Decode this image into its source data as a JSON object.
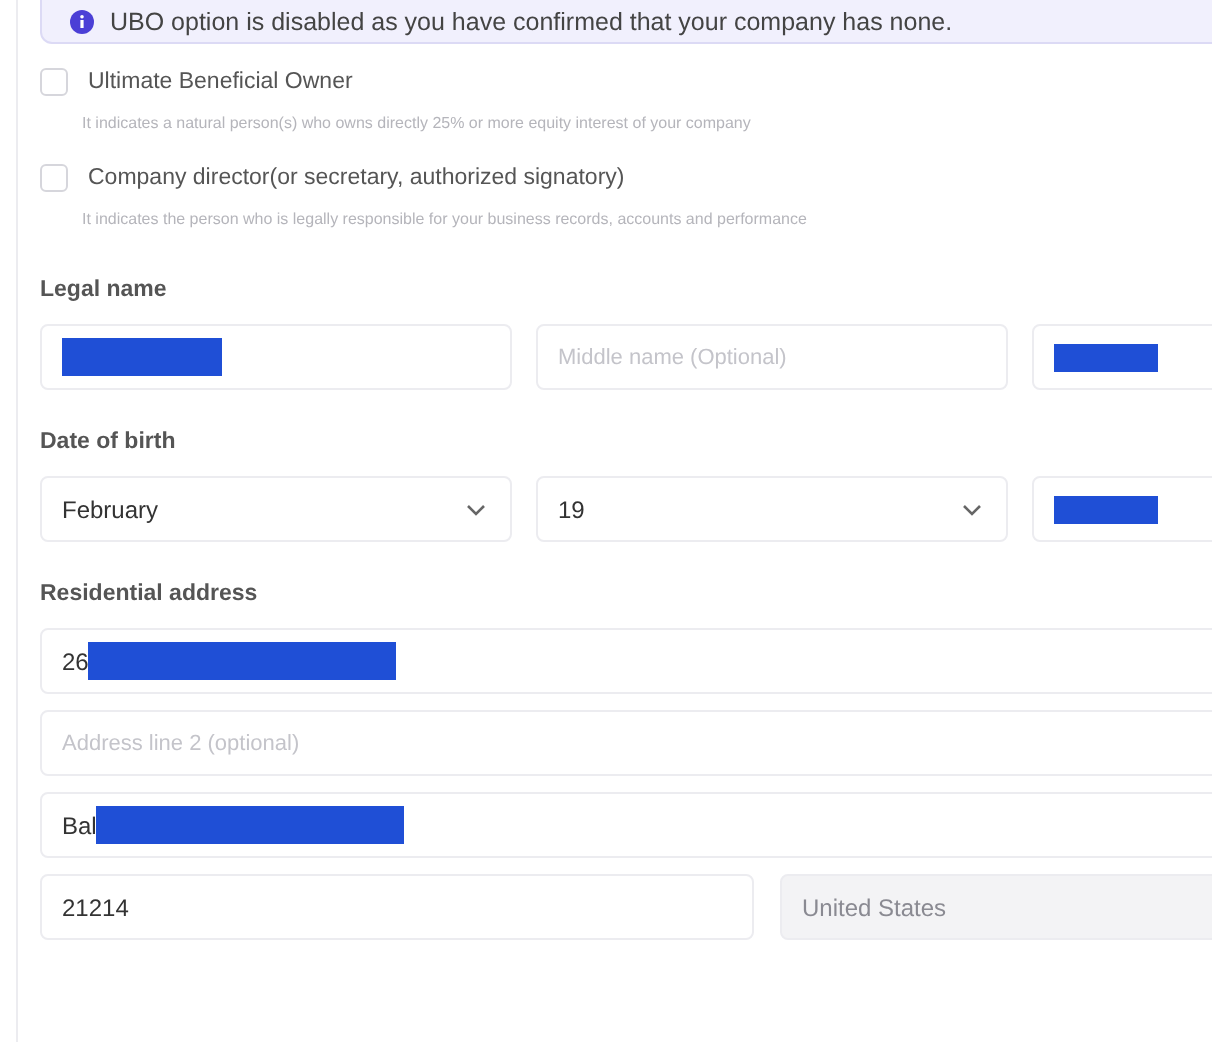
{
  "notice": {
    "text": "UBO option is disabled as you have confirmed that your company has none."
  },
  "roles": [
    {
      "label": "Ultimate Beneficial Owner",
      "description": "It indicates a natural person(s) who owns directly 25% or more equity interest of your company",
      "checked": false
    },
    {
      "label": "Company director(or secretary, authorized signatory)",
      "description": "It indicates the person who is legally responsible for your business records, accounts and performance",
      "checked": false
    }
  ],
  "sections": [
    {
      "label": "Legal name",
      "rows": [
        [
          {
            "kind": "redacted"
          },
          {
            "kind": "text",
            "placeholder": "Middle name (Optional)"
          },
          {
            "kind": "redacted"
          }
        ]
      ]
    },
    {
      "label": "Date of birth",
      "rows": [
        [
          {
            "kind": "select",
            "value": "February"
          },
          {
            "kind": "select",
            "value": "19"
          },
          {
            "kind": "redacted"
          }
        ]
      ]
    },
    {
      "label": "Residential address",
      "rows": [
        [
          {
            "kind": "redacted",
            "value": "26"
          }
        ],
        [
          {
            "kind": "text",
            "placeholder": "Address line 2 (optional)"
          }
        ],
        [
          {
            "kind": "redacted",
            "value": "Bal"
          }
        ],
        [
          {
            "kind": "text",
            "value": "21214"
          },
          {
            "kind": "readonly",
            "value": "United States"
          }
        ]
      ]
    }
  ]
}
